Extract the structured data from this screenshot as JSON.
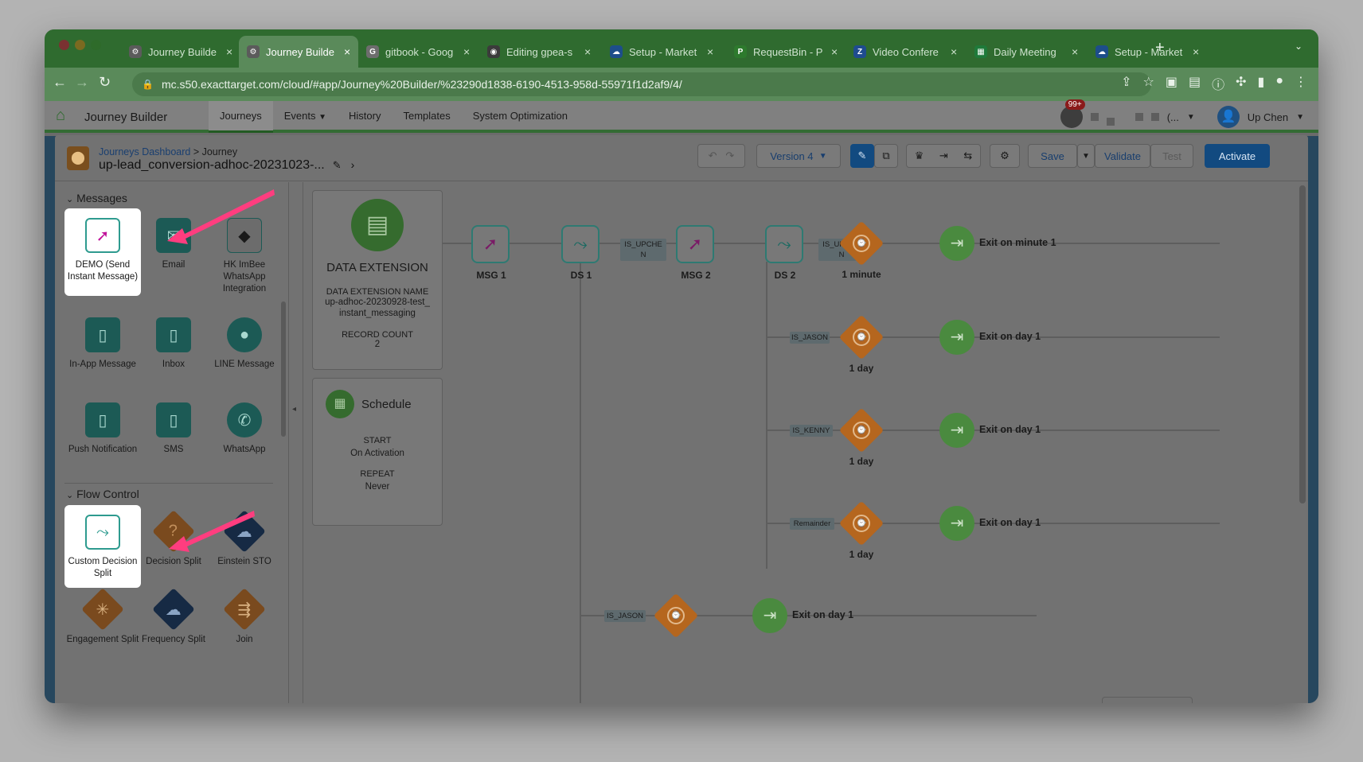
{
  "browser": {
    "tabs": [
      {
        "title": "Journey Builde",
        "favicon": "gear-icon",
        "color": "#5b5b5b",
        "active": false
      },
      {
        "title": "Journey Builde",
        "favicon": "gear-icon",
        "color": "#5b5b5b",
        "active": true
      },
      {
        "title": "gitbook - Goog",
        "favicon": "google-icon",
        "color": "#6d6d6d",
        "active": false
      },
      {
        "title": "Editing gpea-s",
        "favicon": "github-icon",
        "color": "#3b3b3b",
        "active": false
      },
      {
        "title": "Setup - Market",
        "favicon": "salesforce-cloud-icon",
        "color": "#1d4e8a",
        "active": false
      },
      {
        "title": "RequestBin - P",
        "favicon": "pipedream-icon",
        "color": "#2d7a2d",
        "active": false
      },
      {
        "title": "Video Confere",
        "favicon": "zoom-icon",
        "color": "#1f4c8f",
        "active": false
      },
      {
        "title": "Daily Meeting",
        "favicon": "sheets-icon",
        "color": "#1f7a3a",
        "active": false
      },
      {
        "title": "Setup - Market",
        "favicon": "salesforce-cloud-icon",
        "color": "#1d4e8a",
        "active": false
      }
    ],
    "url": "mc.s50.exacttarget.com/cloud/#app/Journey%20Builder/%23290d1838-6190-4513-958d-55971f1d2af9/4/"
  },
  "app": {
    "title": "Journey Builder",
    "nav": [
      "Journeys",
      "Events",
      "History",
      "Templates",
      "System Optimization"
    ],
    "notifications": "99+",
    "ellipsis": "(...",
    "user": "Up Chen"
  },
  "journey": {
    "breadcrumb_link": "Journeys Dashboard",
    "breadcrumb_sep": " > Journey",
    "name": "up-lead_conversion-adhoc-20231023-...",
    "version": "Version 4",
    "save": "Save",
    "validate": "Validate",
    "test": "Test",
    "activate": "Activate"
  },
  "sidebar": {
    "messages_title": "Messages",
    "flow_title": "Flow Control",
    "messages": [
      {
        "label": "DEMO (Send Instant Message)",
        "icon": "instant-message-icon"
      },
      {
        "label": "Email",
        "icon": "envelope-icon"
      },
      {
        "label": "HK ImBee WhatsApp Integration",
        "icon": "imbee-icon"
      },
      {
        "label": "In-App Message",
        "icon": "mobile-icon"
      },
      {
        "label": "Inbox",
        "icon": "inbox-icon"
      },
      {
        "label": "LINE Message",
        "icon": "chat-bubble-icon"
      },
      {
        "label": "Push Notification",
        "icon": "push-icon"
      },
      {
        "label": "SMS",
        "icon": "sms-icon"
      },
      {
        "label": "WhatsApp",
        "icon": "whatsapp-icon"
      }
    ],
    "flow": [
      {
        "label": "Custom Decision Split",
        "icon": "custom-split-icon"
      },
      {
        "label": "Decision Split",
        "icon": "question-icon"
      },
      {
        "label": "Einstein STO",
        "icon": "einstein-icon"
      },
      {
        "label": "Engagement Split",
        "icon": "engagement-icon"
      },
      {
        "label": "Frequency Split",
        "icon": "frequency-icon"
      },
      {
        "label": "Join",
        "icon": "join-icon"
      }
    ]
  },
  "canvas": {
    "entry": {
      "title": "DATA EXTENSION",
      "name_label": "DATA EXTENSION NAME",
      "name_value": "up-adhoc-20230928-test_instant_messaging",
      "count_label": "RECORD COUNT",
      "count_value": "2"
    },
    "schedule": {
      "title": "Schedule",
      "start_label": "START",
      "start_value": "On Activation",
      "repeat_label": "REPEAT",
      "repeat_value": "Never"
    },
    "nodes": {
      "msg1": "MSG 1",
      "ds1": "DS 1",
      "msg2": "MSG 2",
      "ds2": "DS 2",
      "w1": "1 minute",
      "w2": "1 day",
      "w3": "1 day",
      "w4": "1 day"
    },
    "paths": {
      "p1": "IS_UPCHE N",
      "p2": "IS_UPCHE N",
      "p3": "IS_JASON",
      "p4": "IS_KENNY",
      "p5": "Remainder",
      "p6": "IS_JASON"
    },
    "exits": {
      "e1": "Exit on minute 1",
      "e2": "Exit on day 1",
      "e3": "Exit on day 1",
      "e4": "Exit on day 1",
      "e5": "Exit on day 1"
    }
  },
  "colors": {
    "arrow": "#ff3d7f",
    "teal": "#1c5a55",
    "orange": "#b5661e",
    "green": "#4a8a3f"
  }
}
